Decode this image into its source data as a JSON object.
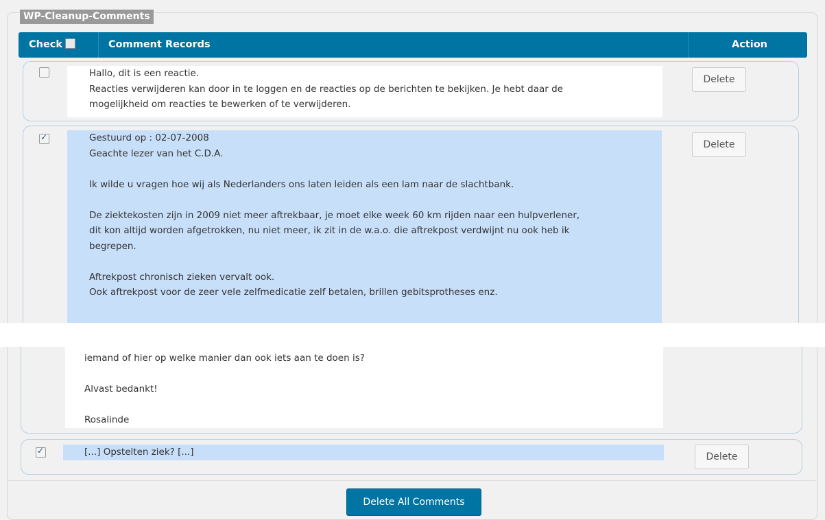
{
  "legend": "WP-Cleanup-Comments",
  "table": {
    "col_check": "Check",
    "col_records": "Comment Records",
    "col_action": "Action"
  },
  "comments": [
    {
      "checked": false,
      "lines": [
        "Hallo, dit is een reactie.",
        "Reacties verwijderen kan door in te loggen en de reacties op de berichten te bekijken. Je hebt daar de",
        "mogelijkheid om reacties te bewerken of te verwijderen."
      ],
      "action": "Delete"
    },
    {
      "checked": true,
      "lines_top": [
        "Gestuurd op : 02-07-2008",
        "Geachte lezer van het C.D.A.",
        "",
        "Ik wilde u vragen hoe wij als Nederlanders ons laten leiden als een lam naar de slachtbank.",
        "",
        "De ziektekosten zijn in 2009 niet meer aftrekbaar, je moet elke week 60 km rijden naar een hulpverlener,",
        "dit kon altijd worden afgetrokken, nu niet meer, ik zit in de w.a.o. die aftrekpost verdwijnt nu ook heb ik",
        "begrepen.",
        "",
        "Aftrekpost chronisch zieken vervalt ook.",
        "Ook aftrekpost voor de zeer vele zelfmedicatie zelf betalen, brillen gebitsprotheses enz."
      ],
      "lines_bottom": [
        "iemand of hier op welke manier dan ook iets aan te doen is?",
        "",
        "Alvast bedankt!",
        "",
        "Rosalinde"
      ],
      "action": "Delete"
    },
    {
      "checked": true,
      "lines": [
        "[...] Opstelten ziek? [...]"
      ],
      "action": "Delete"
    }
  ],
  "delete_all": "Delete All Comments",
  "colors": {
    "header_bg": "#0074a2",
    "selected_bg": "#c8dffa",
    "legend_bg": "#999999"
  }
}
